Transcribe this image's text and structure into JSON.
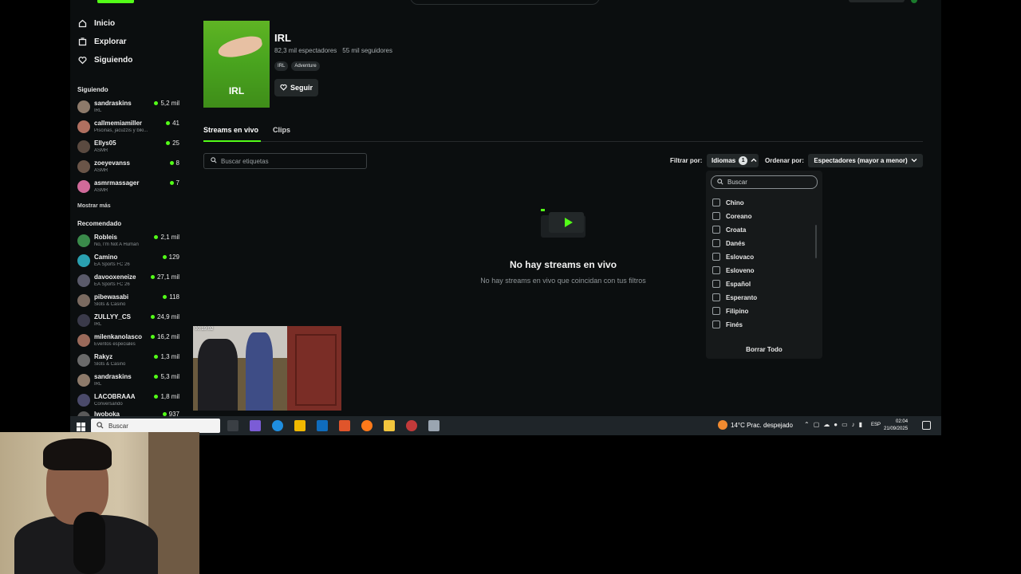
{
  "sidebar": {
    "nav": [
      {
        "label": "Inicio",
        "icon": "home-icon"
      },
      {
        "label": "Explorar",
        "icon": "explore-icon"
      },
      {
        "label": "Siguiendo",
        "icon": "heart-icon"
      }
    ],
    "following_title": "Siguiendo",
    "following": [
      {
        "name": "sandraskins",
        "category": "IRL",
        "viewers": "5,2 mil",
        "color": "#8d7a6a"
      },
      {
        "name": "callmemiamiller",
        "category": "Piscinas, jacuzzis y biki...",
        "viewers": "41",
        "color": "#b07060"
      },
      {
        "name": "Ellys05",
        "category": "ASMR",
        "viewers": "25",
        "color": "#5a4a40"
      },
      {
        "name": "zoeyevanss",
        "category": "ASMR",
        "viewers": "8",
        "color": "#6a5548"
      },
      {
        "name": "asmrmassager",
        "category": "ASMR",
        "viewers": "7",
        "color": "#d06a9a"
      }
    ],
    "show_more": "Mostrar más",
    "recommended_title": "Recomendado",
    "recommended": [
      {
        "name": "Robleis",
        "category": "No, I'm Not A Human",
        "viewers": "2,1 mil",
        "color": "#3a8a4a"
      },
      {
        "name": "Camino",
        "category": "EA Sports FC 26",
        "viewers": "129",
        "color": "#2aa0b0"
      },
      {
        "name": "davooxeneize",
        "category": "EA Sports FC 26",
        "viewers": "27,1 mil",
        "color": "#5a5a6a"
      },
      {
        "name": "pibewasabi",
        "category": "Slots & Casino",
        "viewers": "118",
        "color": "#7a6a60"
      },
      {
        "name": "ZULLYY_CS",
        "category": "IRL",
        "viewers": "24,9 mil",
        "color": "#3a3a4a"
      },
      {
        "name": "milenkanolasco",
        "category": "Eventos especiales",
        "viewers": "16,2 mil",
        "color": "#9a6a5a"
      },
      {
        "name": "Rakyz",
        "category": "Slots & Casino",
        "viewers": "1,3 mil",
        "color": "#6a6a6a"
      },
      {
        "name": "sandraskins",
        "category": "IRL",
        "viewers": "5,3 mil",
        "color": "#8d7a6a"
      },
      {
        "name": "LACOBRAAA",
        "category": "Conversando",
        "viewers": "1,8 mil",
        "color": "#4a4a6a"
      },
      {
        "name": "lwoboka",
        "category": "",
        "viewers": "937",
        "color": "#5a5a5a"
      }
    ]
  },
  "category": {
    "thumb_label": "IRL",
    "title": "IRL",
    "viewers": "82,3 mil espectadores",
    "followers": "55 mil seguidores",
    "tags": [
      "IRL",
      "Adventure"
    ],
    "follow_label": "Seguir"
  },
  "tabs": {
    "live": "Streams en vivo",
    "clips": "Clips"
  },
  "tag_search": {
    "placeholder": "Buscar etiquetas"
  },
  "filters": {
    "filter_label": "Filtrar por:",
    "languages_label": "Idiomas",
    "languages_count": "1",
    "sort_label": "Ordenar por:",
    "sort_value": "Espectadores (mayor a menor)"
  },
  "language_dropdown": {
    "search_placeholder": "Buscar",
    "items": [
      "Chino",
      "Coreano",
      "Croata",
      "Danés",
      "Eslovaco",
      "Esloveno",
      "Español",
      "Esperanto",
      "Filipino",
      "Finés"
    ],
    "clear_all": "Borrar Todo"
  },
  "empty_state": {
    "title": "No hay streams en vivo",
    "subtitle": "No hay streams en vivo que coincidan con tus filtros"
  },
  "preview": {
    "timestamp": "00:19:02"
  },
  "taskbar": {
    "search_placeholder": "Buscar",
    "weather": "14°C  Prac. despejado",
    "lang": "ESP",
    "time": "02:04",
    "date": "21/09/2025"
  },
  "colors": {
    "accent": "#53fc18",
    "background": "#0b0e0f",
    "panel": "#232829"
  }
}
